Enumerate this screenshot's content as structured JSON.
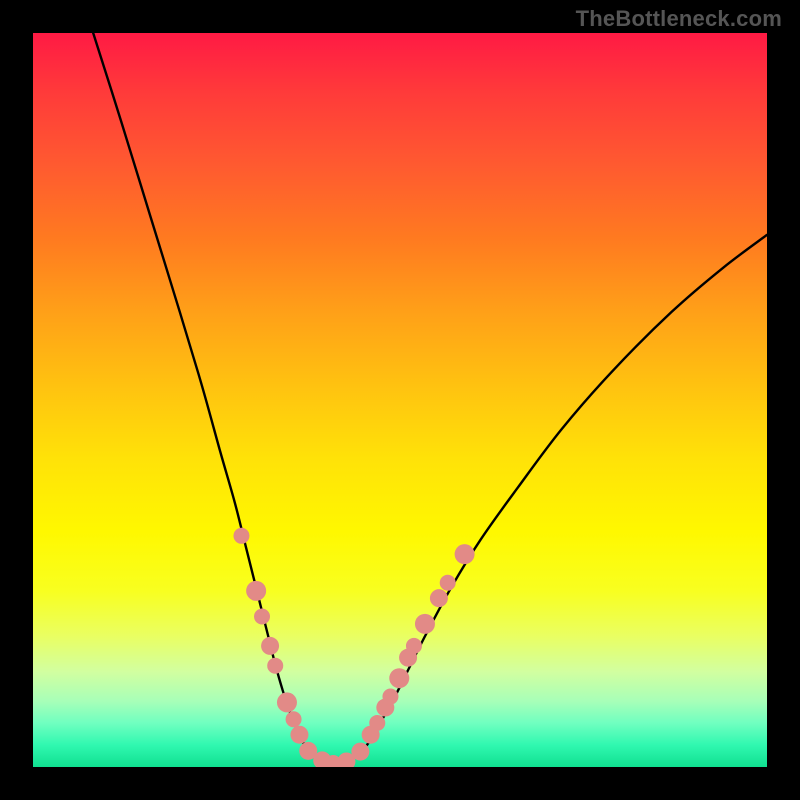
{
  "watermark": "TheBottleneck.com",
  "colors": {
    "curve": "#000000",
    "marker_fill": "#e28a87",
    "marker_stroke": "#c96a66",
    "gradient_top": "#ff1a44",
    "gradient_bottom": "#10e090"
  },
  "chart_data": {
    "type": "line",
    "title": "",
    "xlabel": "",
    "ylabel": "",
    "xlim": [
      0,
      100
    ],
    "ylim": [
      0,
      100
    ],
    "note": "Stylized bottleneck V-curve. Values are visual percentages (x across plot width, y height above bottom). Axes are unlabeled; values estimated from pixel positions.",
    "series": [
      {
        "name": "left-branch",
        "x": [
          8.2,
          12,
          16,
          20,
          23,
          25.5,
          27.5,
          29,
          30.5,
          32,
          33,
          34,
          35,
          36,
          37,
          38
        ],
        "y": [
          100,
          88,
          75,
          62,
          52,
          43,
          36,
          30,
          24,
          18,
          14,
          10.5,
          7.5,
          5,
          3,
          1.8
        ]
      },
      {
        "name": "valley",
        "x": [
          38,
          39,
          40,
          41,
          42,
          43,
          44
        ],
        "y": [
          1.8,
          1.0,
          0.6,
          0.5,
          0.6,
          0.9,
          1.5
        ]
      },
      {
        "name": "right-branch",
        "x": [
          44,
          45.5,
          47,
          49,
          51,
          53.5,
          57,
          61,
          66,
          72,
          79,
          87,
          94,
          100
        ],
        "y": [
          1.5,
          3,
          5.5,
          9,
          13,
          18,
          24.5,
          31,
          38,
          46,
          54,
          62,
          68,
          72.5
        ]
      }
    ],
    "markers": {
      "name": "highlighted-points",
      "points": [
        {
          "x": 28.4,
          "y": 31.5,
          "r": 8
        },
        {
          "x": 30.4,
          "y": 24.0,
          "r": 10
        },
        {
          "x": 31.2,
          "y": 20.5,
          "r": 8
        },
        {
          "x": 32.3,
          "y": 16.5,
          "r": 9
        },
        {
          "x": 33.0,
          "y": 13.8,
          "r": 8
        },
        {
          "x": 34.6,
          "y": 8.8,
          "r": 10
        },
        {
          "x": 35.5,
          "y": 6.5,
          "r": 8
        },
        {
          "x": 36.3,
          "y": 4.4,
          "r": 9
        },
        {
          "x": 37.5,
          "y": 2.2,
          "r": 9
        },
        {
          "x": 39.4,
          "y": 0.9,
          "r": 9
        },
        {
          "x": 40.9,
          "y": 0.55,
          "r": 8
        },
        {
          "x": 42.7,
          "y": 0.75,
          "r": 9
        },
        {
          "x": 44.6,
          "y": 2.1,
          "r": 9
        },
        {
          "x": 46.0,
          "y": 4.4,
          "r": 9
        },
        {
          "x": 46.9,
          "y": 6.0,
          "r": 8
        },
        {
          "x": 48.0,
          "y": 8.1,
          "r": 9
        },
        {
          "x": 48.7,
          "y": 9.6,
          "r": 8
        },
        {
          "x": 49.9,
          "y": 12.1,
          "r": 10
        },
        {
          "x": 51.1,
          "y": 14.9,
          "r": 9
        },
        {
          "x": 51.9,
          "y": 16.5,
          "r": 8
        },
        {
          "x": 53.4,
          "y": 19.5,
          "r": 10
        },
        {
          "x": 55.3,
          "y": 23.0,
          "r": 9
        },
        {
          "x": 56.5,
          "y": 25.1,
          "r": 8
        },
        {
          "x": 58.8,
          "y": 29.0,
          "r": 10
        }
      ]
    }
  }
}
